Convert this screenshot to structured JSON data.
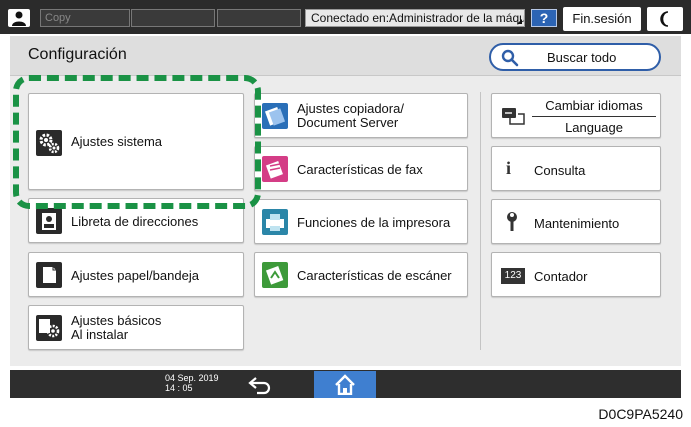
{
  "topbar": {
    "copy_label": "Copy",
    "connection": "Conectado en:Administrador de la máquina",
    "help_label": "?",
    "logout_label": "Fin.sesión"
  },
  "header": {
    "title": "Configuración",
    "search_label": "Buscar todo"
  },
  "left_buttons": [
    {
      "label": "Ajustes sistema"
    },
    {
      "label": "Libreta de direcciones"
    },
    {
      "label": "Ajustes papel/bandeja"
    },
    {
      "line1": "Ajustes básicos",
      "line2": "Al instalar"
    }
  ],
  "middle_buttons": [
    {
      "line1": "Ajustes copiadora/",
      "line2": "Document Server"
    },
    {
      "label": "Características de fax"
    },
    {
      "label": "Funciones de la impresora"
    },
    {
      "label": "Características de escáner"
    }
  ],
  "right_buttons": {
    "language": {
      "line1": "Cambiar idiomas",
      "line2": "Language"
    },
    "inquiry": "Consulta",
    "maintenance": "Mantenimiento",
    "counter": "Contador",
    "counter_icon_text": "123"
  },
  "bottombar": {
    "date": "04 Sep. 2019",
    "time": "14 : 05"
  },
  "figure_code": "D0C9PA5240",
  "colors": {
    "highlight": "#1a9245",
    "accent_blue": "#2f5ea8",
    "home_button": "#3f7fd0"
  }
}
